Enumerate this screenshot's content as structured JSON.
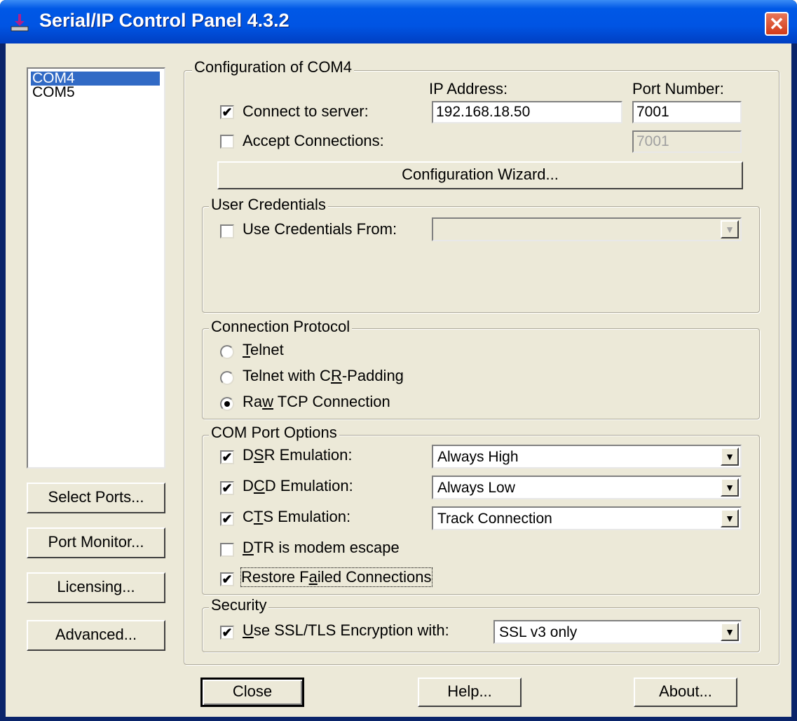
{
  "window": {
    "title": "Serial/IP Control Panel 4.3.2",
    "close_glyph": "✕",
    "icon": "serial-ip-icon"
  },
  "ports": {
    "items": [
      "COM4",
      "COM5"
    ],
    "selected": "COM4"
  },
  "side_buttons": {
    "select_ports": "Select Ports...",
    "port_monitor": "Port Monitor...",
    "licensing": "Licensing...",
    "advanced": "Advanced..."
  },
  "config": {
    "group_title": "Configuration of COM4",
    "ip_header": "IP Address:",
    "port_header": "Port Number:",
    "connect_label": "Connect to server:",
    "connect_checked": true,
    "ip_value": "192.168.18.50",
    "port_value": "7001",
    "accept_label": "Accept Connections:",
    "accept_checked": false,
    "accept_port_value": "7001",
    "wizard_button": "Configuration Wizard..."
  },
  "credentials": {
    "group_title": "User Credentials",
    "use_label": "Use Credentials From:",
    "use_checked": false,
    "source_value": ""
  },
  "protocol": {
    "group_title": "Connection Protocol",
    "options": [
      {
        "pre": "",
        "ul": "T",
        "post": "elnet",
        "selected": false
      },
      {
        "pre": "Telnet with C",
        "ul": "R",
        "post": "-Padding",
        "selected": false
      },
      {
        "pre": "Ra",
        "ul": "w",
        "post": " TCP Connection",
        "selected": true
      }
    ]
  },
  "com_options": {
    "group_title": "COM Port Options",
    "dsr": {
      "pre": "D",
      "ul": "S",
      "post": "R Emulation:",
      "checked": true,
      "value": "Always High"
    },
    "dcd": {
      "pre": "D",
      "ul": "C",
      "post": "D Emulation:",
      "checked": true,
      "value": "Always Low"
    },
    "cts": {
      "pre": "C",
      "ul": "T",
      "post": "S Emulation:",
      "checked": true,
      "value": "Track Connection"
    },
    "dtr": {
      "pre": "",
      "ul": "D",
      "post": "TR is modem escape",
      "checked": false
    },
    "restore": {
      "pre": "Restore F",
      "ul": "a",
      "post": "iled Connections",
      "checked": true
    }
  },
  "security": {
    "group_title": "Security",
    "ssl": {
      "pre": "",
      "ul": "U",
      "post": "se SSL/TLS Encryption with:",
      "checked": true,
      "value": "SSL v3 only"
    }
  },
  "bottom_buttons": {
    "close": "Close",
    "help": "Help...",
    "about": "About..."
  },
  "glyphs": {
    "check": "✔",
    "dropdown": "▼"
  }
}
